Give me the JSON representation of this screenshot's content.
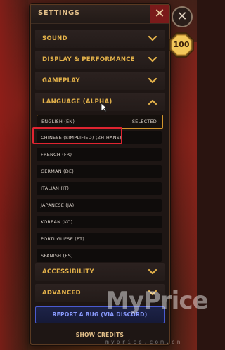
{
  "header": {
    "title": "SETTINGS",
    "close_glyph": "✕"
  },
  "sections": [
    {
      "label": "SOUND",
      "expanded": false
    },
    {
      "label": "DISPLAY & PERFORMANCE",
      "expanded": false
    },
    {
      "label": "GAMEPLAY",
      "expanded": false
    },
    {
      "label": "LANGUAGE (ALPHA)",
      "expanded": true
    },
    {
      "label": "ACCESSIBILITY",
      "expanded": false
    },
    {
      "label": "ADVANCED",
      "expanded": false
    }
  ],
  "languages": [
    {
      "label": "ENGLISH (EN)",
      "status": "SELECTED"
    },
    {
      "label": "CHINESE (SIMPLIFIED) (ZH-HANS)",
      "status": ""
    },
    {
      "label": "FRENCH (FR)",
      "status": ""
    },
    {
      "label": "GERMAN (DE)",
      "status": ""
    },
    {
      "label": "ITALIAN (IT)",
      "status": ""
    },
    {
      "label": "JAPANESE (JA)",
      "status": ""
    },
    {
      "label": "KOREAN (KO)",
      "status": ""
    },
    {
      "label": "PORTUGUESE (PT)",
      "status": ""
    },
    {
      "label": "SPANISH (ES)",
      "status": ""
    }
  ],
  "footer": {
    "bug_report": "REPORT A BUG (VIA DISCORD)",
    "credits": "SHOW CREDITS"
  },
  "side": {
    "close_glyph": "✕",
    "badge_value": "100"
  },
  "watermark": {
    "main": "MyPrice",
    "sub": "myprice.com.cn"
  },
  "colors": {
    "accent_gold": "#e4b24a",
    "selected_border": "#d3952d",
    "highlight_red": "#e02430",
    "discord_blue": "#4a5ad0"
  }
}
